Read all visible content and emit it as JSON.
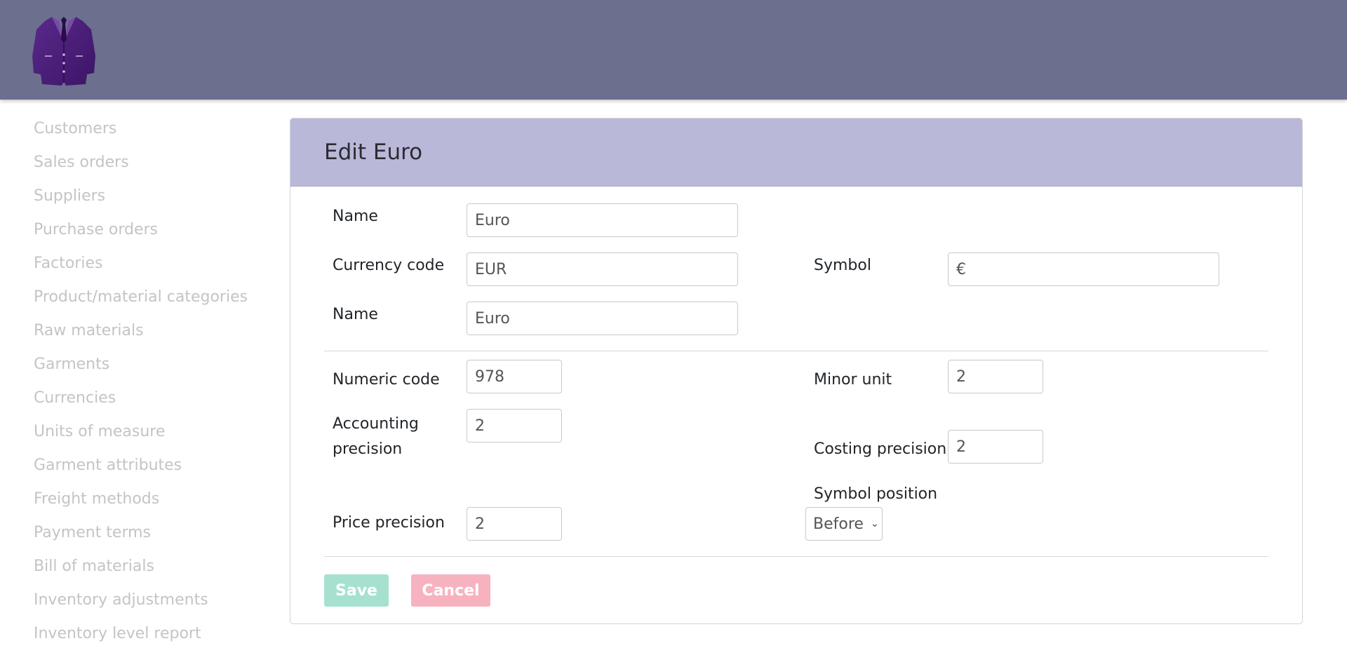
{
  "sidebar": {
    "items": [
      {
        "label": "Customers"
      },
      {
        "label": "Sales orders"
      },
      {
        "label": "Suppliers"
      },
      {
        "label": "Purchase orders"
      },
      {
        "label": "Factories"
      },
      {
        "label": "Product/material categories"
      },
      {
        "label": "Raw materials"
      },
      {
        "label": "Garments"
      },
      {
        "label": "Currencies"
      },
      {
        "label": "Units of measure"
      },
      {
        "label": "Garment attributes"
      },
      {
        "label": "Freight methods"
      },
      {
        "label": "Payment terms"
      },
      {
        "label": "Bill of materials"
      },
      {
        "label": "Inventory adjustments"
      },
      {
        "label": "Inventory level report"
      }
    ]
  },
  "logo": {
    "icon": "suit-jacket-icon",
    "color": "#4a1a7a"
  },
  "form": {
    "title": "Edit Euro",
    "name_label": "Name",
    "name_value": "Euro",
    "currency_code_label": "Currency code",
    "currency_code_value": "EUR",
    "symbol_label": "Symbol",
    "symbol_value": "€",
    "name2_label": "Name",
    "name2_value": "Euro",
    "numeric_code_label": "Numeric code",
    "numeric_code_value": "978",
    "minor_unit_label": "Minor unit",
    "minor_unit_value": "2",
    "accounting_precision_label_line1": "Accounting",
    "accounting_precision_label_line2": "precision",
    "accounting_precision_value": "2",
    "costing_precision_label": "Costing precision",
    "costing_precision_value": "2",
    "symbol_position_label": "Symbol position",
    "symbol_position_value": "Before",
    "price_precision_label": "Price precision",
    "price_precision_value": "2",
    "save_label": "Save",
    "cancel_label": "Cancel"
  },
  "colors": {
    "topbar": "#6c6f8e",
    "card_header": "#b9b8d8",
    "save": "#a6e1cf",
    "cancel": "#f7b2c0",
    "sidebar_text": "#c4c4c4"
  }
}
